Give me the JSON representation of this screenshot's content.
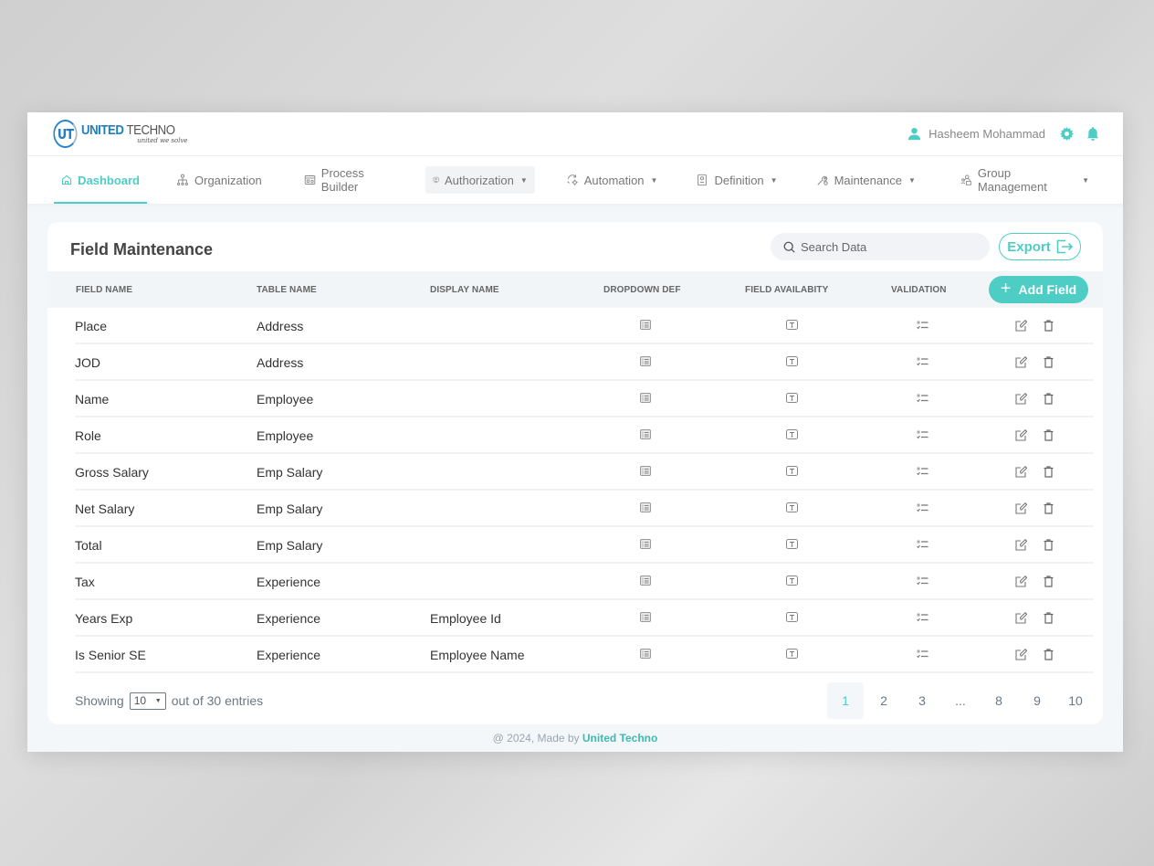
{
  "app": {
    "logo_initials": "UT",
    "logo_brand_1": "UNITED",
    "logo_brand_2": " TECHNO",
    "logo_tagline": "united we solve",
    "accent_color": "#4ecdc4"
  },
  "header": {
    "user_name": "Hasheem Mohammad",
    "icons": [
      "user-icon",
      "gear-icon",
      "bell-icon"
    ]
  },
  "nav": {
    "items": [
      {
        "label": "Dashboard",
        "icon": "home-icon",
        "dropdown": false,
        "active": true
      },
      {
        "label": "Organization",
        "icon": "org-chart-icon",
        "dropdown": false
      },
      {
        "label": "Process Builder",
        "icon": "process-icon",
        "dropdown": false
      },
      {
        "label": "Authorization",
        "icon": "authorization-icon",
        "dropdown": true,
        "hovered": true
      },
      {
        "label": "Automation",
        "icon": "automation-icon",
        "dropdown": true
      },
      {
        "label": "Definition",
        "icon": "definition-icon",
        "dropdown": true
      },
      {
        "label": "Maintenance",
        "icon": "wrench-icon",
        "dropdown": true
      },
      {
        "label": "Group Management",
        "icon": "group-icon",
        "dropdown": true
      }
    ],
    "caret": "▼"
  },
  "page": {
    "title": "Field Maintenance",
    "search_placeholder": "Search Data",
    "export_label": "Export",
    "add_label": "Add Field",
    "add_plus": "+"
  },
  "table": {
    "columns": [
      "FIELD NAME",
      "TABLE NAME",
      "DISPLAY NAME",
      "DROPDOWN DEF",
      "FIELD AVAILABITY",
      "VALIDATION"
    ],
    "rows": [
      {
        "field": "Place",
        "table": "Address",
        "display": ""
      },
      {
        "field": "JOD",
        "table": "Address",
        "display": ""
      },
      {
        "field": "Name",
        "table": "Employee",
        "display": ""
      },
      {
        "field": "Role",
        "table": "Employee",
        "display": ""
      },
      {
        "field": "Gross Salary",
        "table": "Emp Salary",
        "display": ""
      },
      {
        "field": "Net Salary",
        "table": "Emp Salary",
        "display": ""
      },
      {
        "field": "Total",
        "table": "Emp Salary",
        "display": ""
      },
      {
        "field": "Tax",
        "table": "Experience",
        "display": ""
      },
      {
        "field": "Years Exp",
        "table": "Experience",
        "display": "Employee Id"
      },
      {
        "field": "Is Senior SE",
        "table": "Experience",
        "display": "Employee Name"
      }
    ]
  },
  "pagination": {
    "showing_label": "Showing",
    "page_size": "10",
    "entries_label": "out of 30 entries",
    "pages": [
      "1",
      "2",
      "3",
      "...",
      "8",
      "9",
      "10"
    ],
    "current": "1"
  },
  "footer": {
    "prefix": "@ 2024, Made by ",
    "brand": "United Techno"
  }
}
